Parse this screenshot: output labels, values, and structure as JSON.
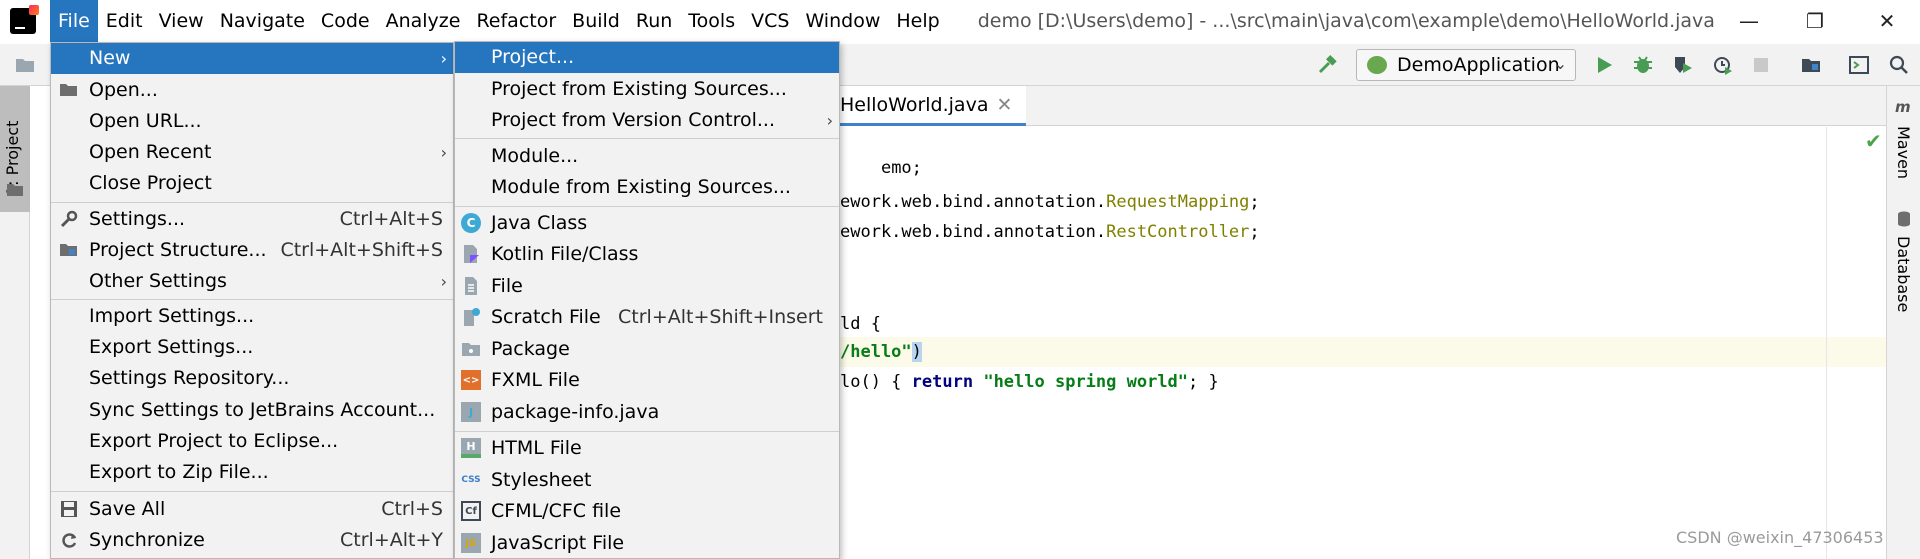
{
  "window": {
    "title": "demo [D:\\Users\\demo] - ...\\src\\main\\java\\com\\example\\demo\\HelloWorld.java",
    "minimize_glyph": "—",
    "restore_glyph": "❐",
    "close_glyph": "✕"
  },
  "menubar": [
    "File",
    "Edit",
    "View",
    "Navigate",
    "Code",
    "Analyze",
    "Refactor",
    "Build",
    "Run",
    "Tools",
    "VCS",
    "Window",
    "Help"
  ],
  "toolbar": {
    "run_configuration": "DemoApplication"
  },
  "left_strip": {
    "project_tab": "1: Project"
  },
  "right_strip": {
    "maven": "Maven",
    "database": "Database"
  },
  "editor": {
    "tab": "HelloWorld.java",
    "lines": {
      "l1": "emo;",
      "l3_prefix": "ework.web.bind.annotation.",
      "l3_ann": "RequestMapping",
      "l3_suffix": ";",
      "l4_prefix": "ework.web.bind.annotation.",
      "l4_ann": "RestController",
      "l4_suffix": ";",
      "l7": "ld {",
      "l8_str": "/hello\"",
      "l8_close": ")",
      "l9_prefix": "lo() { ",
      "l9_kw": "return",
      "l9_str": "\"hello spring world\"",
      "l9_suffix": "; }"
    }
  },
  "file_menu": {
    "items": [
      {
        "label": "New",
        "shortcut": "",
        "arrow": true
      },
      {
        "label": "Open...",
        "shortcut": "",
        "arrow": false
      },
      {
        "label": "Open URL...",
        "shortcut": "",
        "arrow": false
      },
      {
        "label": "Open Recent",
        "shortcut": "",
        "arrow": true
      },
      {
        "label": "Close Project",
        "shortcut": "",
        "arrow": false
      },
      {
        "label": "Settings...",
        "shortcut": "Ctrl+Alt+S",
        "arrow": false
      },
      {
        "label": "Project Structure...",
        "shortcut": "Ctrl+Alt+Shift+S",
        "arrow": false
      },
      {
        "label": "Other Settings",
        "shortcut": "",
        "arrow": true
      },
      {
        "label": "Import Settings...",
        "shortcut": "",
        "arrow": false
      },
      {
        "label": "Export Settings...",
        "shortcut": "",
        "arrow": false
      },
      {
        "label": "Settings Repository...",
        "shortcut": "",
        "arrow": false
      },
      {
        "label": "Sync Settings to JetBrains Account...",
        "shortcut": "",
        "arrow": false
      },
      {
        "label": "Export Project to Eclipse...",
        "shortcut": "",
        "arrow": false
      },
      {
        "label": "Export to Zip File...",
        "shortcut": "",
        "arrow": false
      },
      {
        "label": "Save All",
        "shortcut": "Ctrl+S",
        "arrow": false
      },
      {
        "label": "Synchronize",
        "shortcut": "Ctrl+Alt+Y",
        "arrow": false
      }
    ]
  },
  "new_menu": {
    "items": [
      {
        "label": "Project...",
        "shortcut": "",
        "arrow": false
      },
      {
        "label": "Project from Existing Sources...",
        "shortcut": "",
        "arrow": false
      },
      {
        "label": "Project from Version Control...",
        "shortcut": "",
        "arrow": true
      },
      {
        "label": "Module...",
        "shortcut": "",
        "arrow": false
      },
      {
        "label": "Module from Existing Sources...",
        "shortcut": "",
        "arrow": false
      },
      {
        "label": "Java Class",
        "shortcut": "",
        "arrow": false,
        "icon": "C"
      },
      {
        "label": "Kotlin File/Class",
        "shortcut": "",
        "arrow": false
      },
      {
        "label": "File",
        "shortcut": "",
        "arrow": false
      },
      {
        "label": "Scratch File",
        "shortcut": "Ctrl+Alt+Shift+Insert",
        "arrow": false
      },
      {
        "label": "Package",
        "shortcut": "",
        "arrow": false
      },
      {
        "label": "FXML File",
        "shortcut": "",
        "arrow": false,
        "icon": "<>"
      },
      {
        "label": "package-info.java",
        "shortcut": "",
        "arrow": false,
        "icon": "J"
      },
      {
        "label": "HTML File",
        "shortcut": "",
        "arrow": false,
        "icon": "H"
      },
      {
        "label": "Stylesheet",
        "shortcut": "",
        "arrow": false,
        "icon": "CSS"
      },
      {
        "label": "CFML/CFC file",
        "shortcut": "",
        "arrow": false,
        "icon": "Cf"
      },
      {
        "label": "JavaScript File",
        "shortcut": "",
        "arrow": false,
        "icon": "JS"
      }
    ]
  },
  "watermark": "CSDN @weixin_47306453",
  "colors": {
    "accent": "#2675bf",
    "string": "#067d17",
    "annotation": "#808000",
    "keyword": "#000080"
  }
}
